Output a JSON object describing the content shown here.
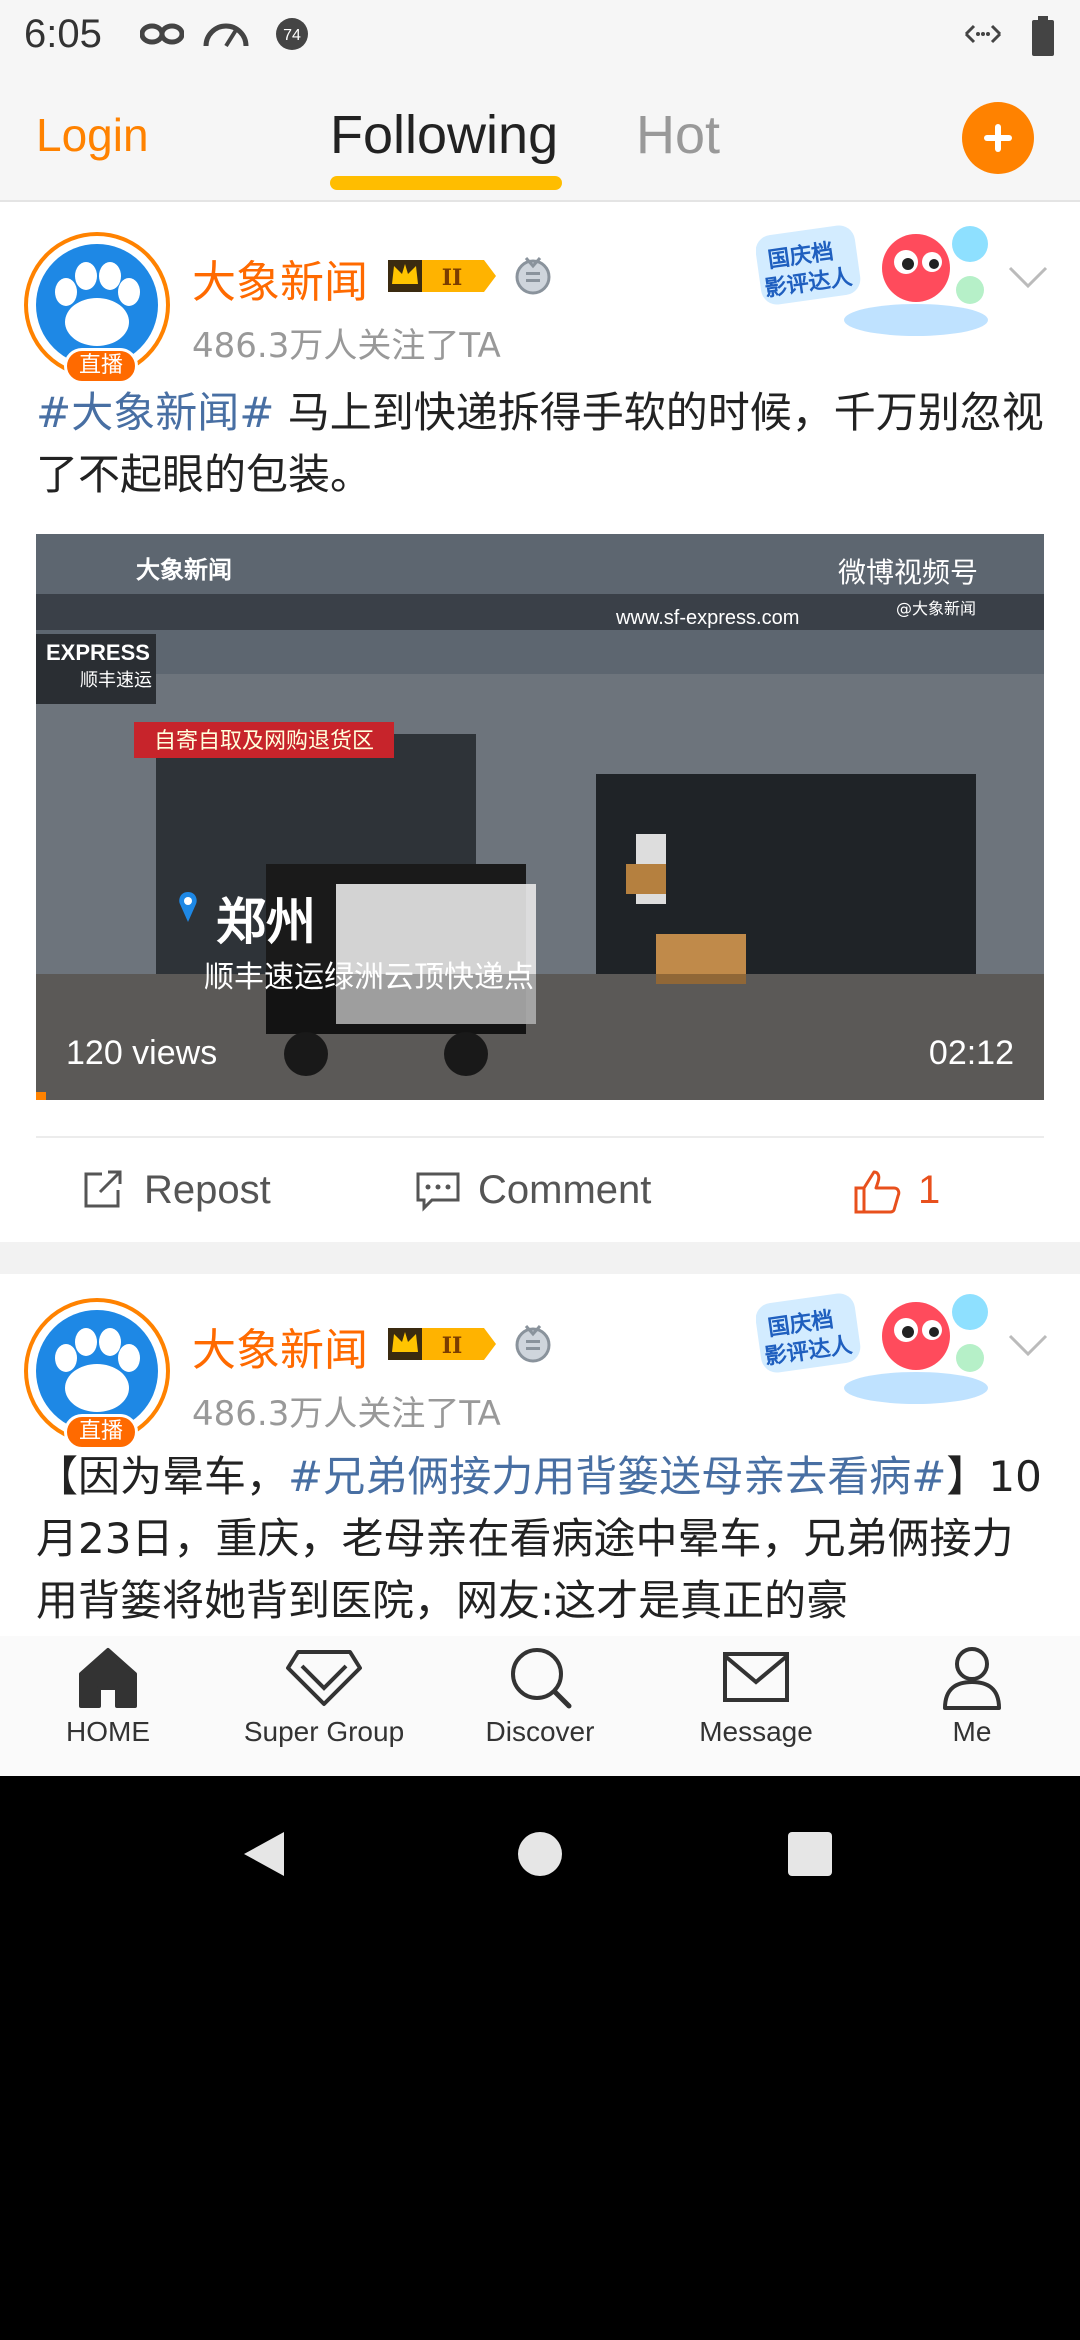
{
  "status_bar": {
    "time": "6:05"
  },
  "top_nav": {
    "login_label": "Login",
    "tabs": [
      {
        "label": "Following",
        "active": true
      },
      {
        "label": "Hot",
        "active": false
      }
    ]
  },
  "posts": [
    {
      "author": "大象新闻",
      "live_label": "直播",
      "followers": "486.3万人关注了TA",
      "promo_text": "国庆档\n影评达人",
      "hashtag": "#大象新闻#",
      "text": " 马上到快递拆得手软的时候，千万别忽视了不起眼的包装。",
      "video": {
        "views": "120 views",
        "duration": "02:12",
        "city": "郑州",
        "address": "顺丰速运绿洲云顶快递点",
        "watermark_brand": "大象新闻",
        "watermark_platform": "微博视频号",
        "watermark_handle": "@大象新闻",
        "store_url": "www.sf-express.com",
        "store_brand": "EXPRESS",
        "store_brand_cn": "顺丰速运",
        "store_sign": "自寄自取及网购退货区",
        "progress": 0.01
      },
      "actions": {
        "repost": "Repost",
        "comment": "Comment",
        "like_count": "1"
      }
    },
    {
      "author": "大象新闻",
      "live_label": "直播",
      "followers": "486.3万人关注了TA",
      "promo_text": "国庆档\n影评达人",
      "text_before": "【因为晕车，",
      "hashtag": "#兄弟俩接力用背篓送母亲去看病#",
      "text_after": "】10月23日，重庆，老母亲在看病途中晕车，兄弟俩接力用背篓将她背到医院，网友:这才是真正的豪"
    }
  ],
  "bottom_nav": [
    {
      "label": "HOME",
      "icon": "home-icon"
    },
    {
      "label": "Super Group",
      "icon": "diamond-icon"
    },
    {
      "label": "Discover",
      "icon": "search-icon"
    },
    {
      "label": "Message",
      "icon": "mail-icon"
    },
    {
      "label": "Me",
      "icon": "person-icon"
    }
  ],
  "colors": {
    "accent": "#ff8200",
    "link": "#486fa3",
    "underline": "#ffbd00"
  }
}
